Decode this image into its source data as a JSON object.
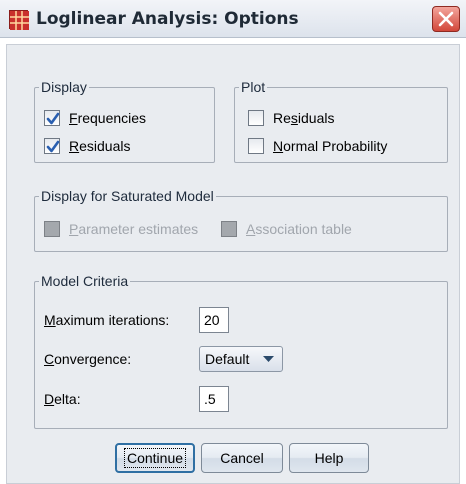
{
  "window": {
    "title": "Loglinear Analysis: Options",
    "icon": "table-icon",
    "close_icon": "close-icon"
  },
  "display_group": {
    "legend": "Display",
    "frequencies": {
      "label_pre": "",
      "mnemonic": "F",
      "label_post": "requencies",
      "checked": true
    },
    "residuals": {
      "label_pre": "",
      "mnemonic": "R",
      "label_post": "esiduals",
      "checked": true
    }
  },
  "plot_group": {
    "legend": "Plot",
    "residuals": {
      "label_pre": "Re",
      "mnemonic": "s",
      "label_post": "iduals",
      "checked": false
    },
    "normal_probability": {
      "label_pre": "",
      "mnemonic": "N",
      "label_post": "ormal Probability",
      "checked": false
    }
  },
  "saturated_group": {
    "legend": "Display for Saturated Model",
    "parameter_estimates": {
      "label_pre": "",
      "mnemonic": "P",
      "label_post": "arameter estimates",
      "enabled": false
    },
    "association_table": {
      "label_pre": "",
      "mnemonic": "A",
      "label_post": "ssociation table",
      "enabled": false
    }
  },
  "criteria_group": {
    "legend": "Model Criteria",
    "max_iterations": {
      "label_pre": "",
      "mnemonic": "M",
      "label_post": "aximum iterations:",
      "value": "20"
    },
    "convergence": {
      "label_pre": "",
      "mnemonic": "C",
      "label_post": "onvergence:",
      "value": "Default"
    },
    "delta": {
      "label_pre": "",
      "mnemonic": "D",
      "label_post": "elta:",
      "value": ".5"
    }
  },
  "buttons": {
    "continue": "Continue",
    "cancel": "Cancel",
    "help": "Help"
  },
  "colors": {
    "accent": "#2f6fa3",
    "check_mark": "#2a5fb0",
    "close_button": "#d2473a",
    "title_icon": "#c9302c"
  }
}
